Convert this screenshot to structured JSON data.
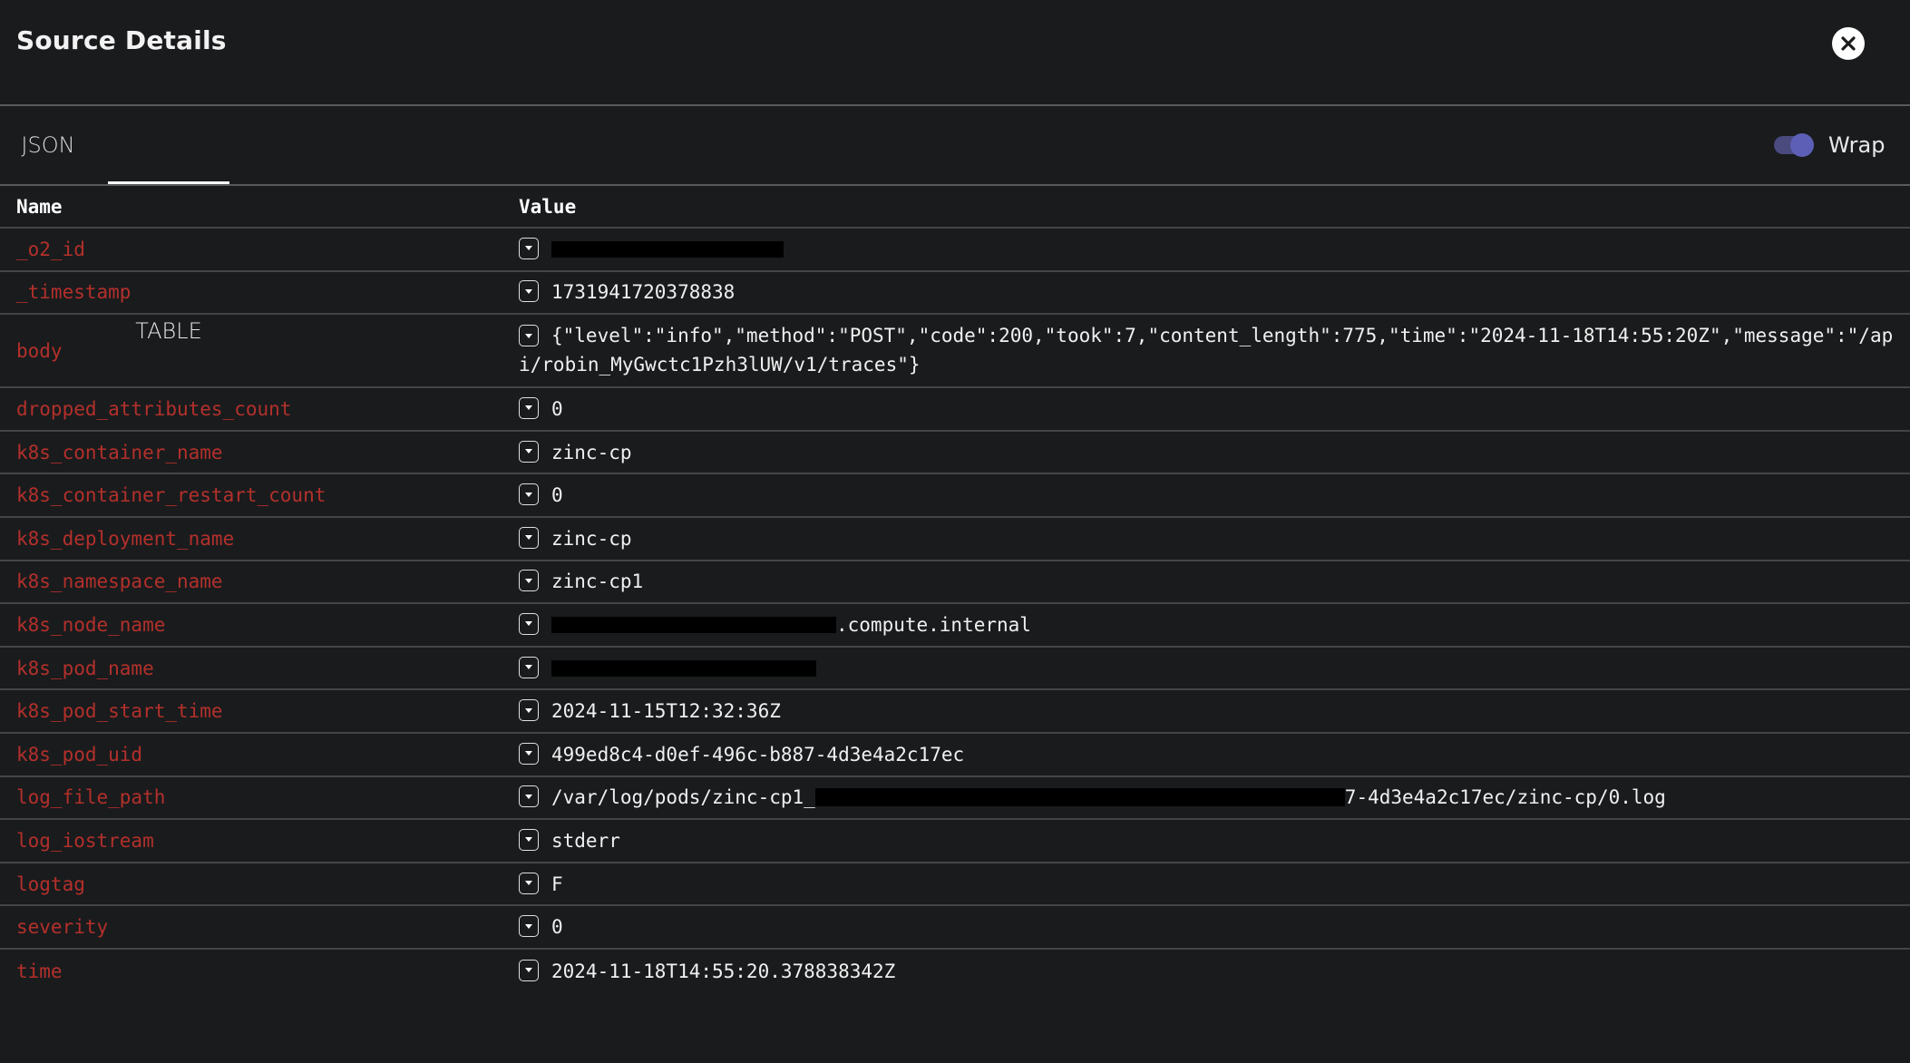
{
  "header": {
    "title": "Source Details",
    "close_icon": "close-circle-icon"
  },
  "tabs": [
    {
      "label": "JSON",
      "active": false
    },
    {
      "label": "TABLE",
      "active": true
    }
  ],
  "wrap_toggle": {
    "label": "Wrap",
    "enabled": true,
    "accent": "#5c5fb5"
  },
  "table": {
    "columns": [
      "Name",
      "Value"
    ],
    "rows": [
      {
        "name": "_o2_id",
        "value": "",
        "redacted": true
      },
      {
        "name": "_timestamp",
        "value": "1731941720378838"
      },
      {
        "name": "body",
        "value": "{\"level\":\"info\",\"method\":\"POST\",\"code\":200,\"took\":7,\"content_length\":775,\"time\":\"2024-11-18T14:55:20Z\",\"message\":\"/api/robin_MyGwctc1Pzh3lUW/v1/traces\"}"
      },
      {
        "name": "dropped_attributes_count",
        "value": "0"
      },
      {
        "name": "k8s_container_name",
        "value": "zinc-cp"
      },
      {
        "name": "k8s_container_restart_count",
        "value": "0"
      },
      {
        "name": "k8s_deployment_name",
        "value": "zinc-cp"
      },
      {
        "name": "k8s_namespace_name",
        "value": "zinc-cp1"
      },
      {
        "name": "k8s_node_name",
        "value_suffix": ".compute.internal",
        "redacted": true
      },
      {
        "name": "k8s_pod_name",
        "value": "",
        "redacted": true
      },
      {
        "name": "k8s_pod_start_time",
        "value": "2024-11-15T12:32:36Z"
      },
      {
        "name": "k8s_pod_uid",
        "value": "499ed8c4-d0ef-496c-b887-4d3e4a2c17ec"
      },
      {
        "name": "log_file_path",
        "value_prefix": "/var/log/pods/zinc-cp1_",
        "value_suffix": "7-4d3e4a2c17ec/zinc-cp/0.log",
        "redacted": true
      },
      {
        "name": "log_iostream",
        "value": "stderr"
      },
      {
        "name": "logtag",
        "value": "F"
      },
      {
        "name": "severity",
        "value": "0"
      },
      {
        "name": "time",
        "value": "2024-11-18T14:55:20.378838342Z"
      }
    ]
  },
  "colors": {
    "background": "#1a1b1d",
    "field_name": "#b3302b",
    "divider": "#444548"
  }
}
